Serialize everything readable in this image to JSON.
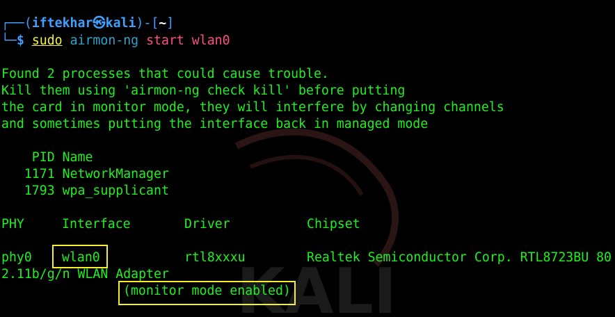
{
  "prompt": {
    "frame_top_left": "┌──(",
    "user": "iftekhar",
    "at_icon": "㉿",
    "host": "kali",
    "frame_mid": ")-[",
    "dir": "~",
    "frame_end": "]",
    "frame_bottom": "└─",
    "dollar": "$"
  },
  "command": {
    "sudo": "sudo",
    "tool": "airmon-ng",
    "args": "start wlan0"
  },
  "output": {
    "warning": [
      "Found 2 processes that could cause trouble.",
      "Kill them using 'airmon-ng check kill' before putting",
      "the card in monitor mode, they will interfere by changing channels",
      "and sometimes putting the interface back in managed mode"
    ],
    "process_header": "    PID Name",
    "processes": [
      "   1171 NetworkManager",
      "   1793 wpa_supplicant"
    ],
    "iface_header": {
      "phy": "PHY",
      "interface": "Interface",
      "driver": "Driver",
      "chipset": "Chipset"
    },
    "iface_row": {
      "phy": "phy0",
      "interface": "wlan0",
      "driver": "rtl8xxxu",
      "chipset": "Realtek Semiconductor Corp. RTL8723BU 80",
      "chipset_wrap": "2.11b/g/n WLAN Adapter"
    },
    "monitor_status": "(monitor mode enabled)"
  },
  "colors": {
    "background": "#000000",
    "output_green": "#1ff01f",
    "prompt_blue": "#3fa0ff",
    "sudo_yellow": "#f2f24a",
    "tool_cyan": "#2fa3c9",
    "args_pink": "#ff4d8a",
    "highlight_yellow": "#f5f02a"
  }
}
